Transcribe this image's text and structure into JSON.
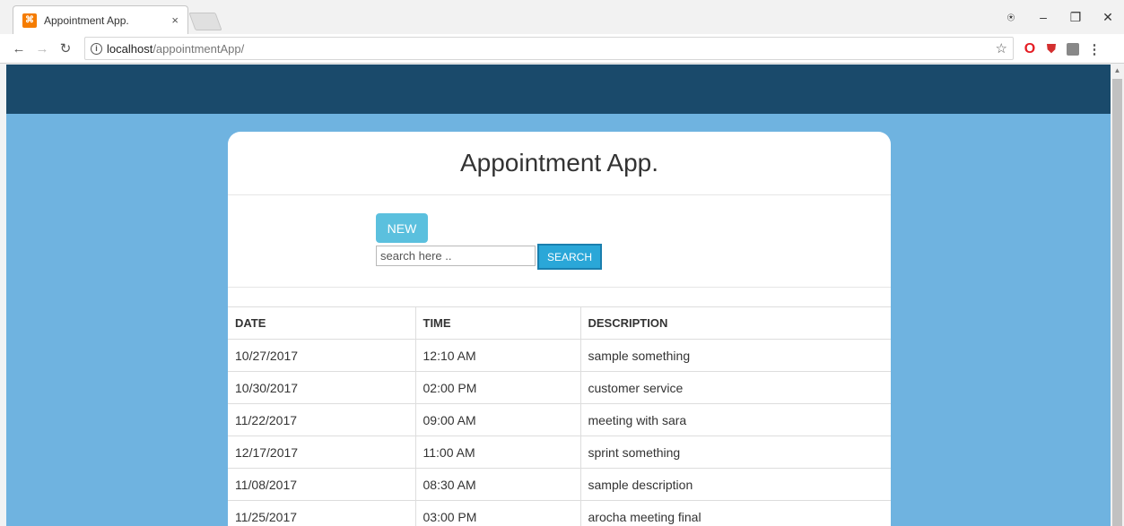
{
  "browser": {
    "tab_title": "Appointment App.",
    "tab_favicon": "xampp-icon",
    "url_host": "localhost",
    "url_path": "/appointmentApp/"
  },
  "app": {
    "title": "Appointment App.",
    "new_label": "NEW",
    "search_placeholder": "search here ..",
    "search_label": "SEARCH"
  },
  "table": {
    "headers": [
      "DATE",
      "TIME",
      "DESCRIPTION"
    ],
    "rows": [
      [
        "10/27/2017",
        "12:10 AM",
        "sample something"
      ],
      [
        "10/30/2017",
        "02:00 PM",
        "customer service"
      ],
      [
        "11/22/2017",
        "09:00 AM",
        "meeting with sara"
      ],
      [
        "12/17/2017",
        "11:00 AM",
        "sprint something"
      ],
      [
        "11/08/2017",
        "08:30 AM",
        "sample description"
      ],
      [
        "11/25/2017",
        "03:00 PM",
        "arocha meeting final"
      ]
    ]
  },
  "colors": {
    "header_bar": "#1a4a6b",
    "page_background": "#6fb3e0",
    "new_button": "#5bc0de",
    "search_button": "#2aa7d8"
  }
}
